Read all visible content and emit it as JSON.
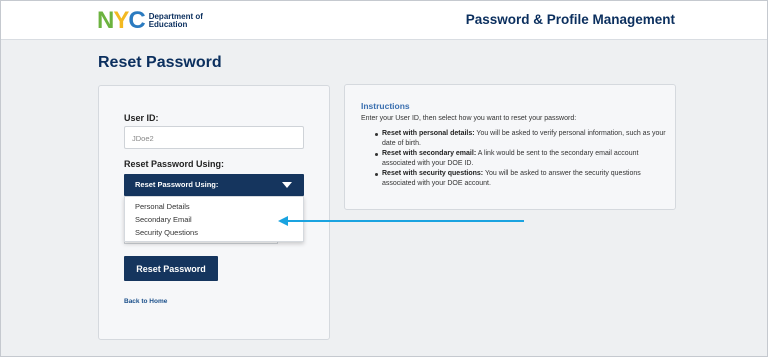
{
  "header": {
    "logo_letters": [
      "N",
      "Y",
      "C"
    ],
    "logo_colors": [
      "#6cb33f",
      "#f3b921",
      "#2b7bc0"
    ],
    "logo_text_line1": "Department of",
    "logo_text_line2": "Education",
    "app_title": "Password & Profile Management"
  },
  "page_title": "Reset Password",
  "form": {
    "userid_label": "User ID:",
    "userid_value": "JDoe2",
    "method_label": "Reset Password Using:",
    "select_value": "Reset Password Using:",
    "options": [
      "Personal Details",
      "Secondary Email",
      "Security Questions"
    ],
    "reset_button_label": "Reset Password",
    "back_link_label": "Back to Home"
  },
  "instructions": {
    "title": "Instructions",
    "intro": "Enter your User ID, then select how you want to reset your password:",
    "items": [
      {
        "bold": "Reset with personal details:",
        "text": " You will be asked to verify personal information, such as your date of birth."
      },
      {
        "bold": "Reset with secondary email:",
        "text": " A link would be sent to the secondary email account associated with your DOE ID."
      },
      {
        "bold": "Reset with security questions:",
        "text": " You will be asked to answer the security questions associated with your DOE account."
      }
    ]
  },
  "colors": {
    "brand_navy": "#15355e",
    "title_navy": "#0b2f5e",
    "instructions_blue": "#3a6fb0",
    "annotation_arrow": "#1aa3e0"
  }
}
